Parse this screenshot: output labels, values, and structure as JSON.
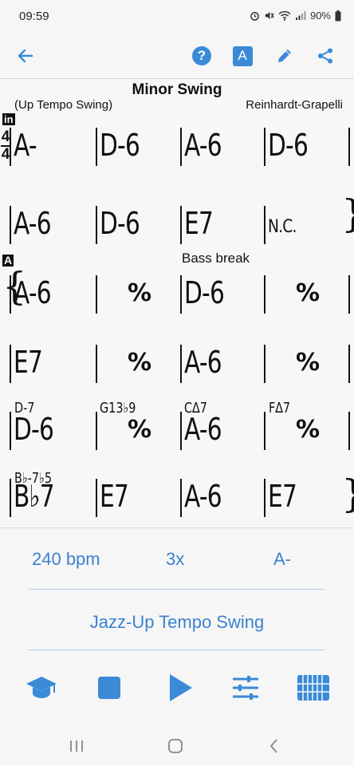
{
  "status": {
    "time": "09:59",
    "battery": "90%"
  },
  "toolbar": {
    "back_icon": "arrow-left-icon",
    "help_glyph": "?",
    "font_glyph": "A",
    "edit_icon": "pencil-icon",
    "share_icon": "share-icon"
  },
  "song": {
    "title": "Minor Swing",
    "style": "(Up Tempo Swing)",
    "composer": "Reinhardt-Grapelli",
    "intro_mark": "in",
    "time_signature": {
      "top": "4",
      "bottom": "4"
    },
    "section_a_mark": "A",
    "bass_break": "Bass break",
    "repeat_symbol": "%",
    "rows": [
      [
        "A-",
        "D-6",
        "A-6",
        "D-6"
      ],
      [
        "A-6",
        "D-6",
        "E7",
        "N.C."
      ],
      [
        "A-6",
        "",
        "D-6",
        ""
      ],
      [
        "E7",
        "",
        "A-6",
        ""
      ],
      [
        "D-6",
        "",
        "A-6",
        ""
      ],
      [
        "B♭7",
        "E7",
        "A-6",
        "E7"
      ]
    ],
    "alt_chords": [
      "D-7",
      "G13♭9",
      "C∆7",
      "F∆7",
      "B♭-7♭5"
    ]
  },
  "controls": {
    "tempo": "240 bpm",
    "repeats": "3x",
    "key": "A-",
    "style": "Jazz-Up Tempo Swing"
  },
  "colors": {
    "accent": "#3a8ad8",
    "text": "#111111",
    "background": "#f6f6f6"
  }
}
